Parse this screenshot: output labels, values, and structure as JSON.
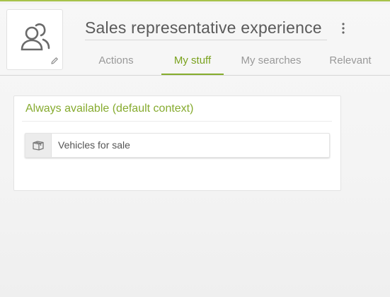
{
  "header": {
    "title": "Sales representative experience",
    "avatar_icon": "user-group-icon",
    "edit_icon": "pencil-icon",
    "menu_icon": "more-vertical-icon"
  },
  "tabs": [
    {
      "label": "Actions",
      "active": false
    },
    {
      "label": "My stuff",
      "active": true
    },
    {
      "label": "My searches",
      "active": false
    },
    {
      "label": "Relevant",
      "active": false
    }
  ],
  "context_card": {
    "title": "Always available (default context)",
    "items": [
      {
        "label": "Vehicles for sale",
        "icon": "box-icon"
      }
    ]
  },
  "colors": {
    "accent": "#86ad2c",
    "tab_inactive": "#999999",
    "title": "#5a5a5a"
  }
}
